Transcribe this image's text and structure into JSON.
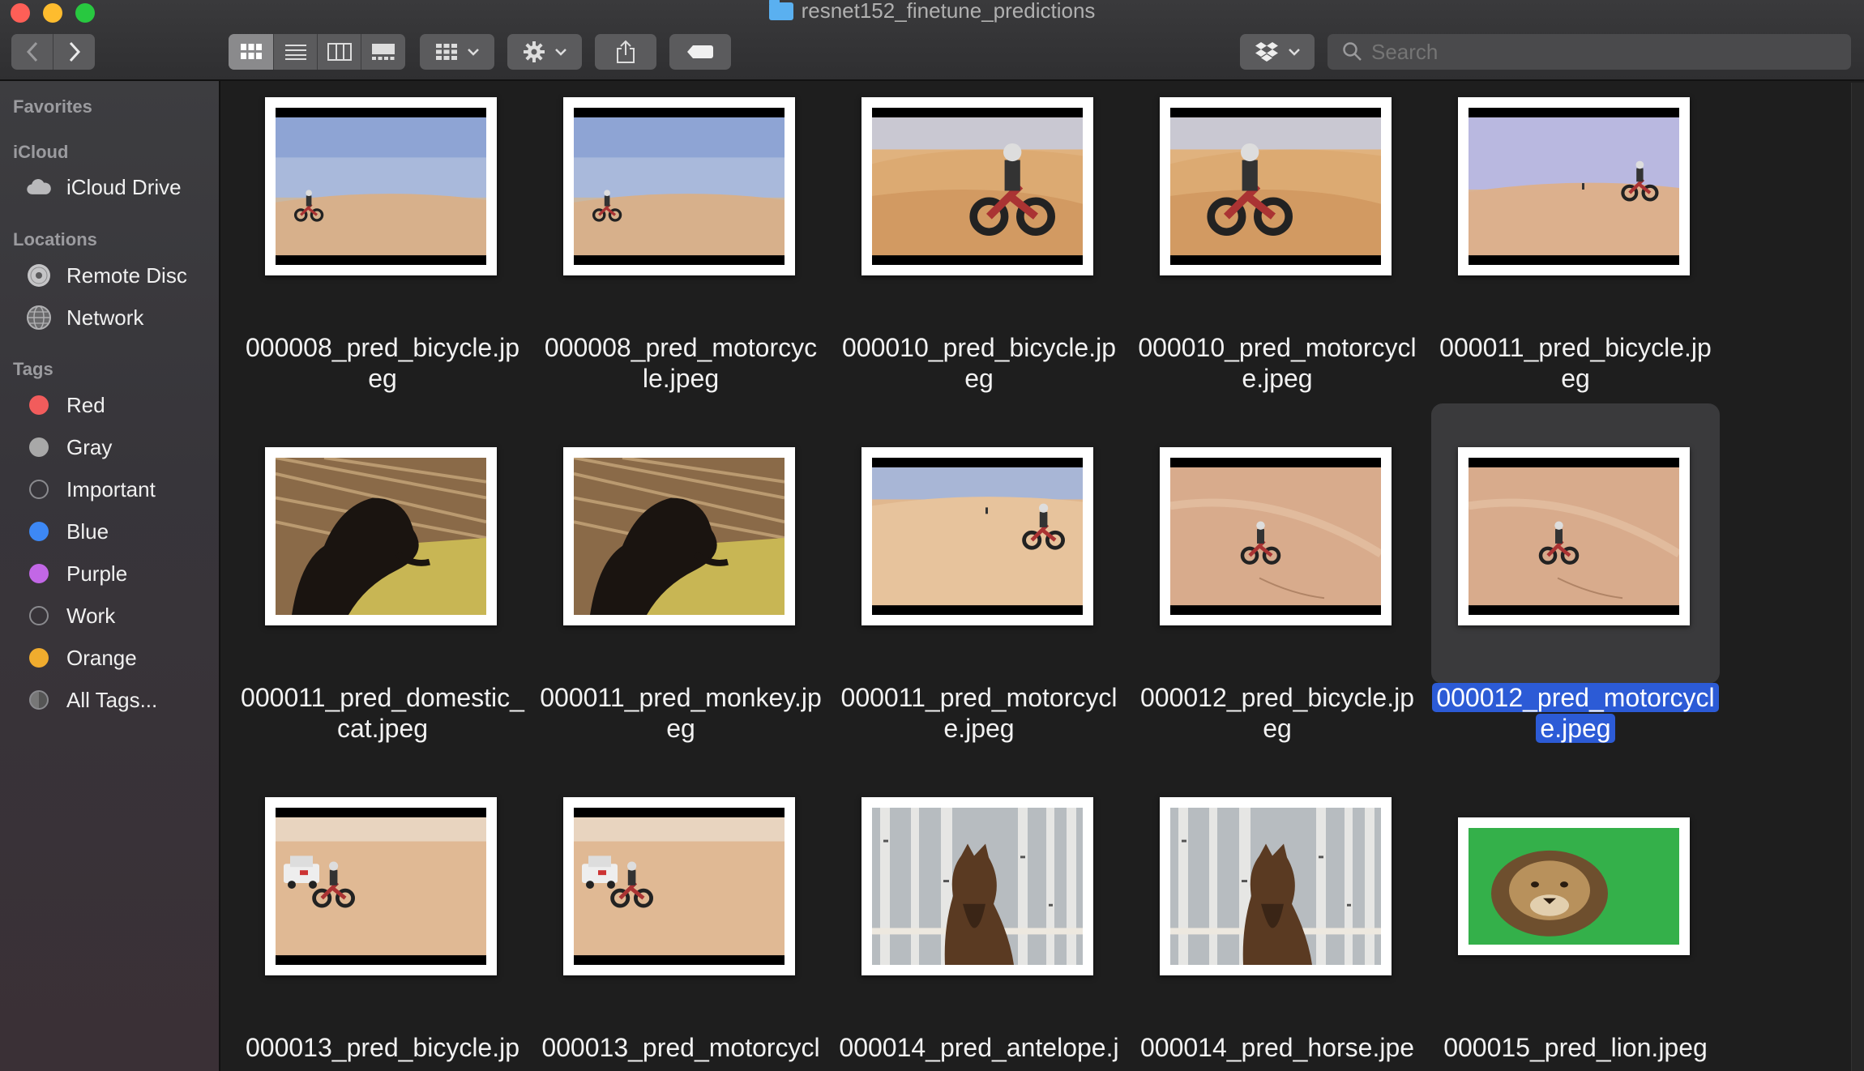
{
  "window": {
    "title": "resnet152_finetune_predictions"
  },
  "toolbar": {
    "search_placeholder": "Search",
    "back_icon": "chevron-left-icon",
    "forward_icon": "chevron-right-icon"
  },
  "sidebar": {
    "favorites_header": "Favorites",
    "icloud_header": "iCloud",
    "icloud_items": [
      {
        "label": "iCloud Drive",
        "icon": "cloud-icon"
      }
    ],
    "locations_header": "Locations",
    "location_items": [
      {
        "label": "Remote Disc",
        "icon": "disc-icon"
      },
      {
        "label": "Network",
        "icon": "globe-icon"
      }
    ],
    "tags_header": "Tags",
    "tags": [
      {
        "label": "Red",
        "color": "#f25c5c"
      },
      {
        "label": "Gray",
        "color": "#a8a8a8"
      },
      {
        "label": "Important",
        "color": ""
      },
      {
        "label": "Blue",
        "color": "#3d88f5"
      },
      {
        "label": "Purple",
        "color": "#c267e6"
      },
      {
        "label": "Work",
        "color": ""
      },
      {
        "label": "Orange",
        "color": "#f0ac2e"
      },
      {
        "label": "All Tags...",
        "color": "all"
      }
    ]
  },
  "files": [
    {
      "line1": "000008_pred_bicycle.jp",
      "line2": "eg",
      "scene": "desert-far"
    },
    {
      "line1": "000008_pred_motorcyc",
      "line2": "le.jpeg",
      "scene": "desert-far"
    },
    {
      "line1": "000010_pred_bicycle.jp",
      "line2": "eg",
      "scene": "desert-near"
    },
    {
      "line1": "000010_pred_motorcycl",
      "line2": "e.jpeg",
      "scene": "desert-near2"
    },
    {
      "line1": "000011_pred_bicycle.jp",
      "line2": "eg",
      "scene": "desert-two"
    },
    {
      "line1": "000011_pred_domestic_",
      "line2": "cat.jpeg",
      "scene": "monkey"
    },
    {
      "line1": "000011_pred_monkey.jp",
      "line2": "eg",
      "scene": "monkey"
    },
    {
      "line1": "000011_pred_motorcycl",
      "line2": "e.jpeg",
      "scene": "dune-rider"
    },
    {
      "line1": "000012_pred_bicycle.jp",
      "line2": "eg",
      "scene": "sand-slope"
    },
    {
      "line1": "000012_pred_motorcycl",
      "line2": "e.jpeg",
      "scene": "sand-slope",
      "selected": true
    },
    {
      "line1": "000013_pred_bicycle.jp",
      "line2": "",
      "scene": "car-rider"
    },
    {
      "line1": "000013_pred_motorcycl",
      "line2": "",
      "scene": "car-rider"
    },
    {
      "line1": "000014_pred_antelope.j",
      "line2": "",
      "scene": "horse"
    },
    {
      "line1": "000014_pred_horse.jpe",
      "line2": "",
      "scene": "horse"
    },
    {
      "line1": "000015_pred_lion.jpeg",
      "line2": "",
      "scene": "lion"
    }
  ]
}
